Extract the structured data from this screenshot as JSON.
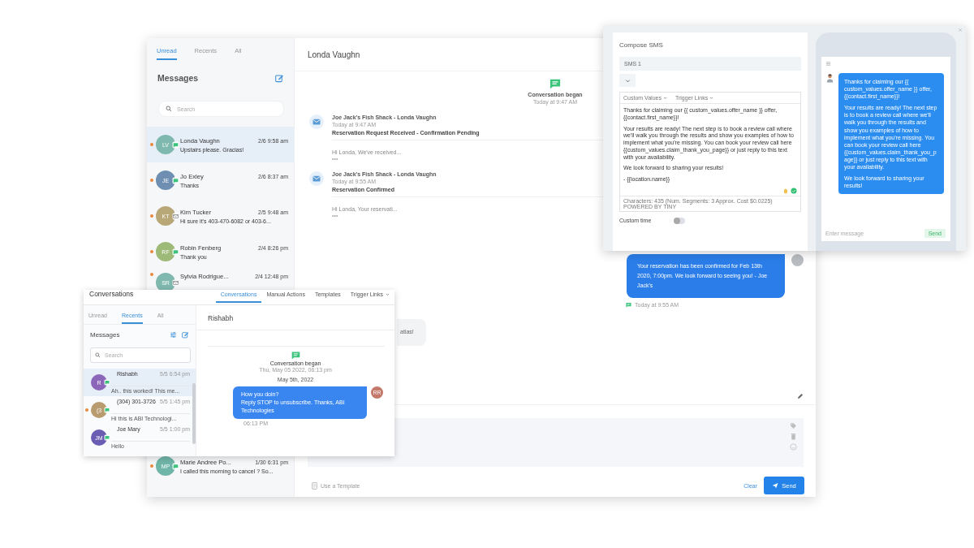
{
  "main_window": {
    "tabs": [
      {
        "label": "Unread",
        "selected": true
      },
      {
        "label": "Recents",
        "selected": false
      },
      {
        "label": "All",
        "selected": false
      }
    ],
    "heading": "Messages",
    "search": {
      "placeholder": "Search"
    },
    "conversations": [
      {
        "initials": "LV",
        "color": "#7fb8ae",
        "kind": "sms",
        "unread": true,
        "selected": true,
        "name": "Londa Vaughn",
        "time": "2/6 9:58 am",
        "preview": "Upstairs please. Gracias!"
      },
      {
        "initials": "JE",
        "color": "#6f8fb2",
        "kind": "sms",
        "unread": true,
        "selected": false,
        "name": "Jo Exley",
        "time": "2/6 8:37 am",
        "preview": "Thanks"
      },
      {
        "initials": "KT",
        "color": "#b8a878",
        "kind": "email",
        "unread": true,
        "selected": false,
        "name": "Kim Tucker",
        "time": "2/5 9:48 am",
        "preview": "Hi sure it's 403-470-6082 or 403-6..."
      },
      {
        "initials": "RF",
        "color": "#9dba78",
        "kind": "sms",
        "unread": true,
        "selected": false,
        "name": "Robin Fenberg",
        "time": "2/4 8:26 pm",
        "preview": "Thank you"
      },
      {
        "initials": "SR",
        "color": "#7fb8ae",
        "kind": "email",
        "unread": true,
        "selected": false,
        "name": "Sylvia Rodrigue...",
        "time": "2/4 12:48 pm"
      }
    ],
    "more_conversations": [
      {
        "initials": "MP",
        "color": "#6fb5a8",
        "kind": "sms",
        "unread": true,
        "selected": false,
        "name": "Marie Andree Po...",
        "time": "1/30 6:31 pm",
        "preview": "I called this morning to cancel ? So..."
      }
    ],
    "chat": {
      "title": "Londa Vaughn",
      "began": {
        "label": "Conversation began",
        "time": "Today at 9:47 AM"
      },
      "messages": [
        {
          "kind": "email",
          "from": "Joe Jack's Fish Shack - Londa Vaughn",
          "time": "Today at 9:47 AM",
          "subject": "Reservation Request Received - Confirmation Pending",
          "preview": "Hi Londa, We've received...",
          "more": "•••"
        },
        {
          "kind": "email",
          "from": "Joe Jack's Fish Shack - Londa Vaughn",
          "time": "Today at 9:55 AM",
          "subject": "Reservation Confirmed",
          "preview": "Hi Londa, Your reservati...",
          "more": "•••"
        },
        {
          "kind": "outgoing",
          "text": "Your reservation has been confirmed for Feb 13th 2020, 7:00pm. We look forward to seeing you! - Joe Jack's",
          "time": "Today at 9:55 AM"
        },
        {
          "kind": "incoming",
          "text": "atias!"
        }
      ]
    },
    "composer": {
      "template_link": "Use a Template",
      "clear": "Clear",
      "send": "Send"
    }
  },
  "compose_sms": {
    "title": "Compose SMS",
    "message_name": "SMS 1",
    "toolbar": [
      "Custom Values",
      "Trigger Links"
    ],
    "body": [
      "Thanks for claiming our {{ custom_values.offer_name }} offer, {{contact.first_name}}!",
      "Your results are ready! The next step is to book a review call where we'll walk you through the results and show you examples of how to implement what you're missing. You can book your review call here {{custom_values.claim_thank_you_page}} or just reply to this text with your availability.",
      "We look forward to sharing your results!",
      "- {{location.name}}"
    ],
    "footer": "Characters: 435 (Num. Segments: 3 Approx. Cost $0.0225)",
    "powered_by": "POWERED BY TINY",
    "custom_time": {
      "label": "Custom time",
      "on": false
    },
    "preview": {
      "bubble": [
        "Thanks for claiming our {{ custom_values.offer_name }} offer, {{contact.first_name}}!",
        "Your results are ready! The next step is to book a review call where we'll walk you through the results and show you examples of how to implement what you're missing. You can book your review call here {{custom_values.claim_thank_you_page}} or just reply to this text with your availability.",
        "We look forward to sharing your results!"
      ],
      "placeholder": "Enter message",
      "send": "Send"
    }
  },
  "inset_window": {
    "title": "Conversations",
    "nav": [
      {
        "label": "Conversations",
        "kind": "tab",
        "selected": true
      },
      {
        "label": "Manual Actions",
        "kind": "tab",
        "selected": false
      },
      {
        "label": "Templates",
        "kind": "tab",
        "selected": false
      },
      {
        "label": "Trigger Links",
        "kind": "dropdown",
        "selected": false
      }
    ],
    "tabs": [
      {
        "label": "Unread",
        "selected": false
      },
      {
        "label": "Recents",
        "selected": true
      },
      {
        "label": "All",
        "selected": false
      }
    ],
    "heading": "Messages",
    "search": {
      "placeholder": "Search"
    },
    "conversations": [
      {
        "initials": "R",
        "color": "#8c66b8",
        "kind": "sms",
        "unread": false,
        "selected": true,
        "name": "Rishabh",
        "time": "5/5 6:54 pm",
        "preview": "Ah.. this worked! This me..."
      },
      {
        "initials": "(3",
        "color": "#b89b6e",
        "kind": "sms",
        "unread": true,
        "selected": false,
        "name": "(304) 301-3726",
        "time": "5/5 1:45 pm",
        "preview": "Hi this is ABI Technologi..."
      },
      {
        "initials": "JM",
        "color": "#6a5cb2",
        "kind": "sms",
        "unread": false,
        "selected": false,
        "name": "Joe Mary",
        "time": "5/5 1:00 pm",
        "preview": "Hello"
      }
    ],
    "chat": {
      "title": "Rishabh",
      "began": {
        "label": "Conversation began",
        "time": "Thu, May 05 2022, 06:13 pm"
      },
      "date": "May 5th, 2022",
      "message": {
        "lines": [
          "How you doin?",
          "Reply STOP to unsubscribe. Thanks, ABI Technologies"
        ],
        "time": "06:13 PM",
        "avatar": "RR"
      }
    }
  }
}
